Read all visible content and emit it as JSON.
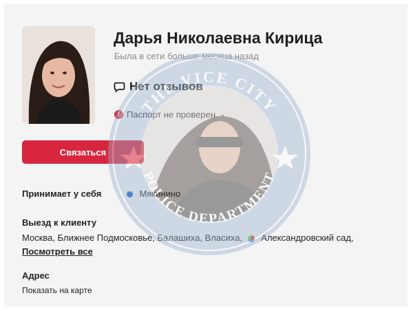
{
  "profile": {
    "name": "Дарья Николаевна Кирица",
    "status": "Была в сети больше месяца назад",
    "reviews_label": "Нет отзывов",
    "passport_label": "Паспорт не проверен",
    "contact_button": "Связаться"
  },
  "details": {
    "receives_label": "Принимает у себя",
    "receives_metro": "Мякинино",
    "visit_label": "Выезд к клиенту",
    "visit_places": "Москва, Ближнее Подмосковье, Балашиха, Власиха,",
    "visit_metro": "Александровский сад,",
    "see_all": "Посмотреть все",
    "address_label": "Адрес",
    "address_value": "Показать на карте"
  },
  "watermark": {
    "top_text": "THE VICE CITY",
    "bottom_text": "POLICE DEPARTMENT"
  },
  "colors": {
    "accent": "#d7263d",
    "metro_blue": "#1565c0",
    "status_gray": "#8a8a8a"
  },
  "icons": [
    "chat-bubble-icon",
    "warning-icon",
    "chevron-down-icon",
    "metro-line-icon",
    "star-icon"
  ]
}
